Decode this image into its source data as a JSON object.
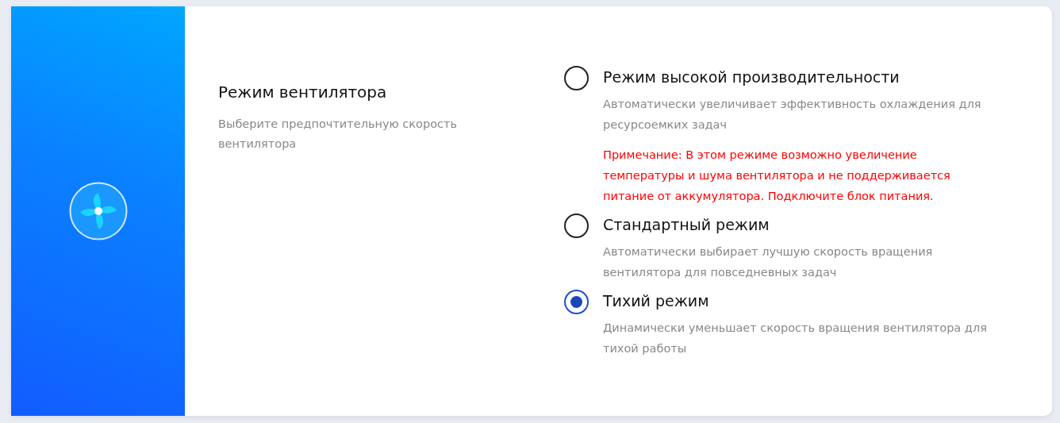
{
  "section": {
    "title": "Режим вентилятора",
    "description": "Выберите предпочтительную скорость вентилятора"
  },
  "options": [
    {
      "label": "Режим высокой производительности",
      "description": "Автоматически увеличивает эффективность охлаждения для ресурсоемких задач",
      "note": "Примечание: В этом режиме возможно увеличение температуры и шума вентилятора и не поддерживается питание от аккумулятора. Подключите блок питания.",
      "selected": false
    },
    {
      "label": "Стандартный режим",
      "description": "Автоматически выбирает лучшую скорость вращения вентилятора для повседневных задач",
      "selected": false
    },
    {
      "label": "Тихий режим",
      "description": "Динамически уменьшает скорость вращения вентилятора для тихой работы",
      "selected": true
    }
  ]
}
